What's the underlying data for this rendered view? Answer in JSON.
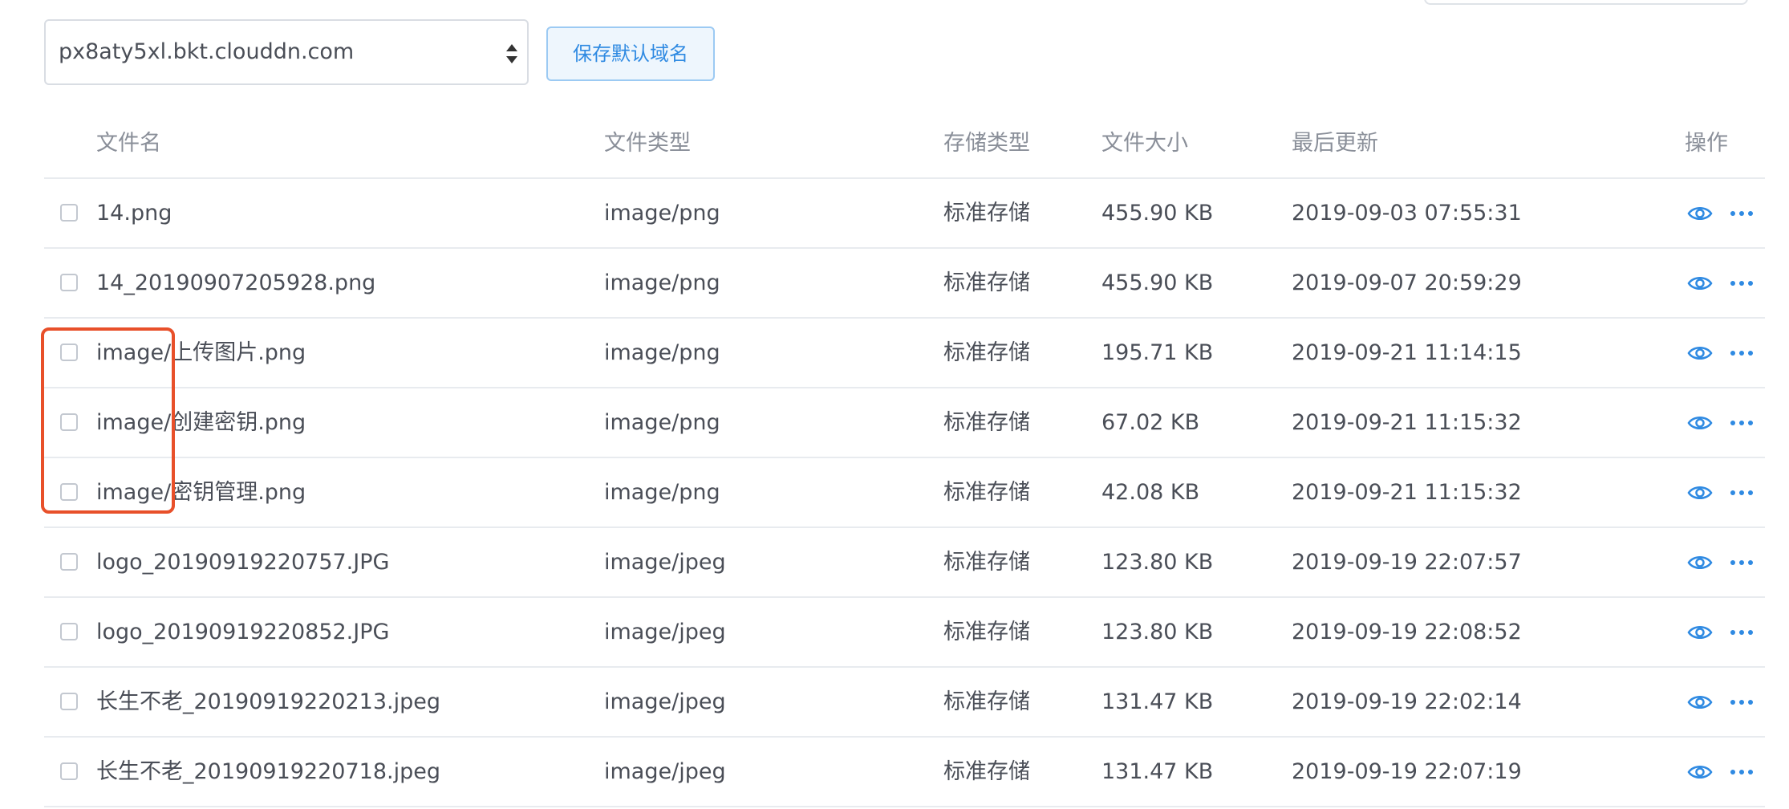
{
  "domain_selector": {
    "value": "px8aty5xl.bkt.clouddn.com"
  },
  "save_default_domain_label": "保存默认域名",
  "columns": {
    "name": "文件名",
    "type": "文件类型",
    "storage": "存储类型",
    "size": "文件大小",
    "updated": "最后更新",
    "actions": "操作"
  },
  "rows": [
    {
      "name": "14.png",
      "type": "image/png",
      "storage": "标准存储",
      "size": "455.90 KB",
      "updated": "2019-09-03 07:55:31"
    },
    {
      "name": "14_20190907205928.png",
      "type": "image/png",
      "storage": "标准存储",
      "size": "455.90 KB",
      "updated": "2019-09-07 20:59:29"
    },
    {
      "name": "image/上传图片.png",
      "type": "image/png",
      "storage": "标准存储",
      "size": "195.71 KB",
      "updated": "2019-09-21 11:14:15"
    },
    {
      "name": "image/创建密钥.png",
      "type": "image/png",
      "storage": "标准存储",
      "size": "67.02 KB",
      "updated": "2019-09-21 11:15:32"
    },
    {
      "name": "image/密钥管理.png",
      "type": "image/png",
      "storage": "标准存储",
      "size": "42.08 KB",
      "updated": "2019-09-21 11:15:32"
    },
    {
      "name": "logo_20190919220757.JPG",
      "type": "image/jpeg",
      "storage": "标准存储",
      "size": "123.80 KB",
      "updated": "2019-09-19 22:07:57"
    },
    {
      "name": "logo_20190919220852.JPG",
      "type": "image/jpeg",
      "storage": "标准存储",
      "size": "123.80 KB",
      "updated": "2019-09-19 22:08:52"
    },
    {
      "name": "长生不老_20190919220213.jpeg",
      "type": "image/jpeg",
      "storage": "标准存储",
      "size": "131.47 KB",
      "updated": "2019-09-19 22:02:14"
    },
    {
      "name": "长生不老_20190919220718.jpeg",
      "type": "image/jpeg",
      "storage": "标准存储",
      "size": "131.47 KB",
      "updated": "2019-09-19 22:07:19"
    }
  ],
  "icons": {
    "preview": "eye-icon",
    "more": "more-icon",
    "select": "select-arrows-icon"
  },
  "colors": {
    "accent": "#2f8ae2",
    "highlight": "#e8502a",
    "text": "#4a4e57",
    "header_text": "#8a8f99"
  }
}
